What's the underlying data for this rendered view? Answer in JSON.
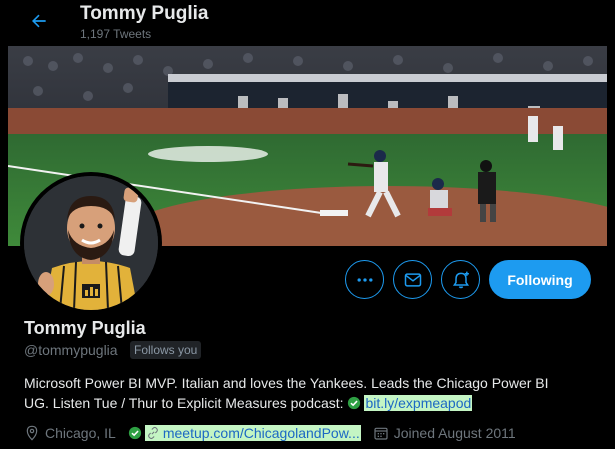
{
  "header": {
    "back_icon": "arrow-left-icon",
    "name": "Tommy Puglia",
    "tweet_count": "1,197 Tweets"
  },
  "actions": {
    "more_icon": "more-horizontal-icon",
    "message_icon": "envelope-icon",
    "notify_icon": "bell-plus-icon",
    "following_label": "Following"
  },
  "profile": {
    "name": "Tommy Puglia",
    "handle": "@tommypuglia",
    "follows_you": "Follows you",
    "bio_line1": "Microsoft Power BI MVP. Italian and loves the Yankees. Leads the Chicago Power BI",
    "bio_line2": "UG. Listen Tue / Thur to Explicit Measures podcast:",
    "bio_link": "bit.ly/expmeapod",
    "location": "Chicago, IL",
    "website": "meetup.com/ChicagolandPow...",
    "joined": "Joined August 2011"
  },
  "colors": {
    "accent": "#1d9bf0",
    "background": "#000000",
    "muted": "#6e767d",
    "link_highlight": "#c4f5c4"
  }
}
